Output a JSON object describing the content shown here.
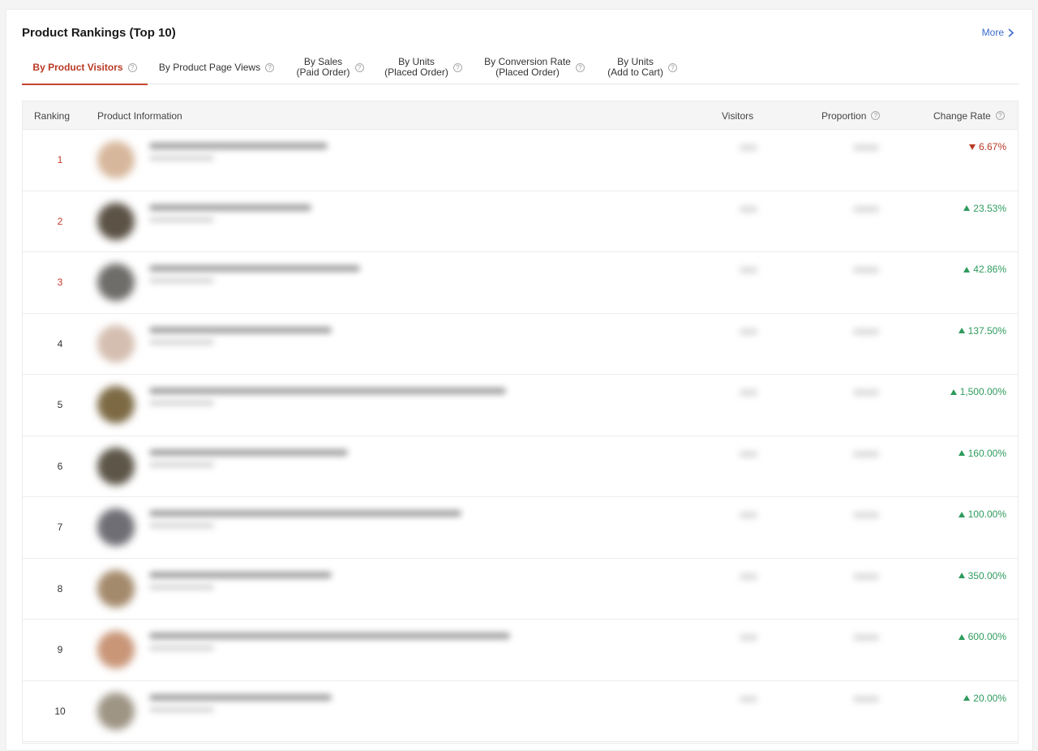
{
  "header": {
    "title": "Product Rankings (Top 10)",
    "more_label": "More"
  },
  "tabs": [
    {
      "label": "By Product Visitors",
      "active": true
    },
    {
      "label": "By Product Page Views",
      "active": false
    },
    {
      "label": "By Sales\n(Paid Order)",
      "active": false
    },
    {
      "label": "By Units\n(Placed Order)",
      "active": false
    },
    {
      "label": "By Conversion Rate\n(Placed Order)",
      "active": false
    },
    {
      "label": "By Units\n(Add to Cart)",
      "active": false
    }
  ],
  "table": {
    "columns": {
      "ranking": "Ranking",
      "product_info": "Product Information",
      "visitors": "Visitors",
      "proportion": "Proportion",
      "change_rate": "Change Rate"
    },
    "rows": [
      {
        "rank": "1",
        "change": "6.67%",
        "direction": "down",
        "thumb_color": "#d7b79c"
      },
      {
        "rank": "2",
        "change": "23.53%",
        "direction": "up",
        "thumb_color": "#5c5346"
      },
      {
        "rank": "3",
        "change": "42.86%",
        "direction": "up",
        "thumb_color": "#6f6d6a"
      },
      {
        "rank": "4",
        "change": "137.50%",
        "direction": "up",
        "thumb_color": "#d4beb0"
      },
      {
        "rank": "5",
        "change": "1,500.00%",
        "direction": "up",
        "thumb_color": "#7d6a45"
      },
      {
        "rank": "6",
        "change": "160.00%",
        "direction": "up",
        "thumb_color": "#5d5648"
      },
      {
        "rank": "7",
        "change": "100.00%",
        "direction": "up",
        "thumb_color": "#6e6e74"
      },
      {
        "rank": "8",
        "change": "350.00%",
        "direction": "up",
        "thumb_color": "#a48a6c"
      },
      {
        "rank": "9",
        "change": "600.00%",
        "direction": "up",
        "thumb_color": "#c99678"
      },
      {
        "rank": "10",
        "change": "20.00%",
        "direction": "up",
        "thumb_color": "#9e9585"
      }
    ]
  },
  "colors": {
    "accent": "#c9442b",
    "up": "#2e9b5d",
    "down": "#b83a24",
    "link": "#3b6ac9"
  }
}
